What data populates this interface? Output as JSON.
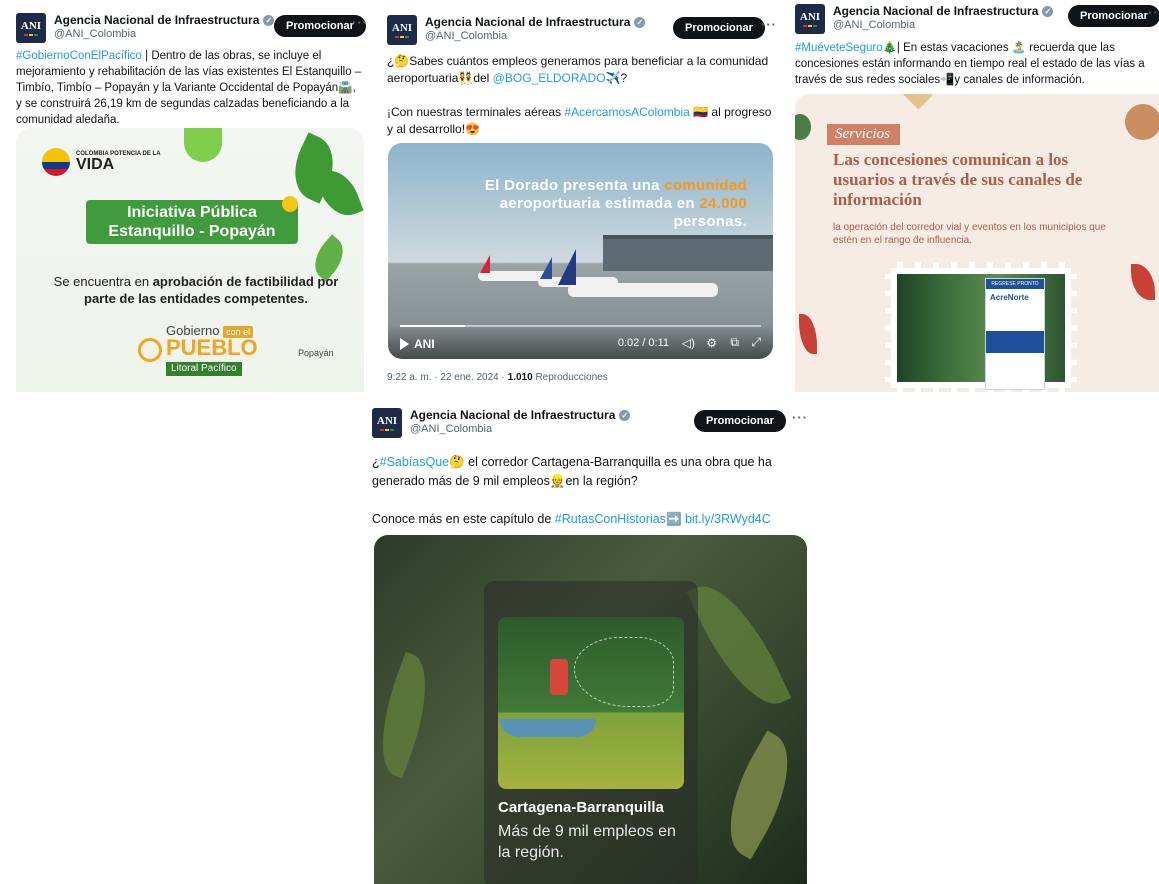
{
  "account": {
    "name": "Agencia Nacional de Infraestructura",
    "handle": "@ANI_Colombia",
    "avatar_text": "ANI",
    "promote_label": "Promocionar",
    "more_label": "···"
  },
  "tweets": [
    {
      "text_parts": {
        "hashtag": "#GobiernoConElPacífico",
        "body": " | Dentro de las obras, se incluye el mejoramiento y rehabilitación de las vías existentes El Estanquillo – Timbío, Timbío – Popayán y la Variante Occidental de Popayán🛣️, y se construirá 26,19 km de segundas calzadas beneficiando a la comunidad aledaña."
      },
      "media": {
        "logo_small": "COLOMBIA POTENCIA DE LA",
        "logo_big": "VIDA",
        "banner": "Iniciativa Pública Estanquillo - Popayán",
        "approval_pre": "Se encuentra en ",
        "approval_bold": "aprobación de factibilidad por parte de las entidades competentes.",
        "gob_a": "Gobierno",
        "gob_badge": "con el",
        "gob_b": "PUEBLO",
        "gob_c": "Litoral Pacífico",
        "map_label": "Popayán"
      }
    },
    {
      "text_parts": {
        "q1": "¿🤔Sabes cuántos empleos generamos para beneficiar a la comunidad aeroportuaria👯del ",
        "mention": "@BOG_ELDORADO",
        "q2": "✈️?",
        "p2_pre": "¡Con nuestras terminales aéreas ",
        "p2_tag": "#AcercamosAColombia",
        "p2_post": " 🇨🇴 al progreso y al desarrollo!😍"
      },
      "media": {
        "title_a": "El Dorado presenta una ",
        "title_or1": "comunidad",
        "title_b": " aeroportuaria estimada en ",
        "title_or2": "24.000",
        "title_c": " personas.",
        "logo": "ANI",
        "time": "0:02 / 0:11",
        "progress": 0.18
      },
      "meta": {
        "timestamp": "9:22 a. m. · 22 ene. 2024 · ",
        "views": "1.010",
        "views_label": " Reproducciones"
      }
    },
    {
      "text_parts": {
        "hashtag": "#MuéveteSeguro",
        "body": "🎄| En estas vacaciones 🏝️ recuerda que las concesiones están informando en tiempo real el estado de las vías a través de sus redes sociales📲y canales de información."
      },
      "media": {
        "tag": "Servicios",
        "title": "Las concesiones comunican a los usuarios a través de sus canales de información",
        "sub": "la operación del corredor vial y eventos en los municipios que estén en el rango de influencia.",
        "sign_top": "REGRESE PRONTO",
        "sign_name": "AcreNorte"
      }
    },
    {
      "text_parts": {
        "q_pre": "¿",
        "hashtag": "#SabíasQue",
        "q_body": "🤔 el corredor Cartagena-Barranquilla es una obra que ha generado más de 9 mil empleos👷en la región?",
        "p2_pre": "Conoce más en este capítulo de ",
        "p2_tag": "#RutasConHistorias",
        "p2_arrow": "➡️ ",
        "p2_link": "bit.ly/3RWyd4C"
      },
      "media": {
        "caption_title": "Cartagena-Barranquilla",
        "caption_body": "Más de 9 mil empleos en la región."
      }
    }
  ],
  "colors": {
    "link": "#1d9bf0",
    "text": "#0f1419",
    "muted": "#536471",
    "promo_bg": "#0f1419",
    "ani_green": "#3f9b3c",
    "servicios_rose": "#b05c48"
  },
  "icons": [
    "verified-badge-icon",
    "more-options-icon",
    "play-icon",
    "volume-icon",
    "settings-icon",
    "pip-icon",
    "fullscreen-icon"
  ]
}
